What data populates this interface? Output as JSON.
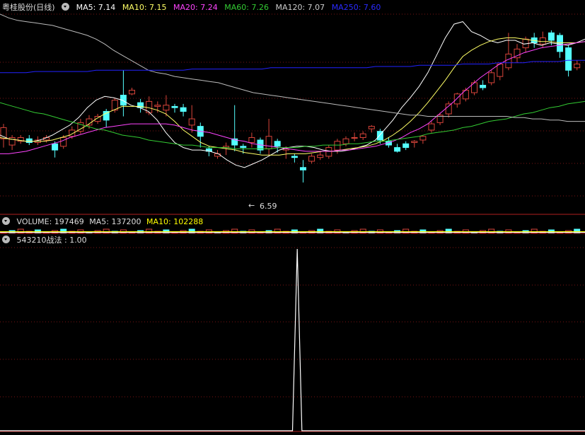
{
  "colors": {
    "bg": "#000000",
    "up": "#d9443a",
    "down": "#54ffff",
    "grid": "#7a1414",
    "ma5": "#ffffff",
    "ma10": "#ffff66",
    "ma20": "#ff44ff",
    "ma60": "#33cc33",
    "ma120": "#bbbbbb",
    "ma250": "#2222ff",
    "vma10": "#ffff00",
    "signal": "#ffffff"
  },
  "header": {
    "stock_name": "粤桂股份(日线)",
    "ma5": "MA5: 7.14",
    "ma10": "MA10: 7.15",
    "ma20": "MA20: 7.24",
    "ma60": "MA60: 7.26",
    "ma120": "MA120: 7.07",
    "ma250": "MA250: 7.60"
  },
  "volume_header": {
    "volume": "VOLUME: 197469",
    "ma5": "MA5: 137200",
    "ma10": "MA10: 102288"
  },
  "indicator_header": {
    "label": "543210战法 : 1.00"
  },
  "annotation": {
    "low_label": "6.59",
    "arrow_icon": "left-arrow-icon"
  },
  "chart_data": [
    {
      "type": "candlestick",
      "title": "粤桂股份(日线)",
      "ylim": [
        6.45,
        8.05
      ],
      "series": [
        {
          "name": "MA5",
          "values": [
            7.08,
            7.05,
            7.04,
            7.03,
            7.03,
            7.05,
            7.08,
            7.12,
            7.16,
            7.22,
            7.3,
            7.36,
            7.39,
            7.38,
            7.36,
            7.32,
            7.3,
            7.27,
            7.2,
            7.1,
            7.02,
            6.98,
            6.96,
            6.96,
            6.95,
            6.93,
            6.88,
            6.84,
            6.82,
            6.85,
            6.88,
            6.92,
            6.96,
            6.98,
            6.99,
            6.99,
            6.98,
            6.96,
            6.95,
            6.95,
            6.96,
            6.98,
            7.0,
            7.04,
            7.12,
            7.2,
            7.3,
            7.38,
            7.47,
            7.58,
            7.72,
            7.86,
            7.97,
            7.99,
            7.91,
            7.88,
            7.84,
            7.82,
            7.84,
            7.84,
            7.81,
            7.82,
            7.8,
            7.82,
            7.81,
            7.8,
            7.82,
            7.85
          ]
        },
        {
          "name": "MA10",
          "values": [
            7.06,
            7.05,
            7.04,
            7.03,
            7.03,
            7.03,
            7.04,
            7.06,
            7.08,
            7.12,
            7.16,
            7.21,
            7.25,
            7.28,
            7.31,
            7.31,
            7.31,
            7.3,
            7.28,
            7.25,
            7.19,
            7.12,
            7.07,
            7.02,
            6.99,
            6.98,
            6.97,
            6.96,
            6.94,
            6.93,
            6.92,
            6.92,
            6.92,
            6.93,
            6.93,
            6.93,
            6.94,
            6.95,
            6.95,
            6.96,
            6.97,
            6.98,
            6.99,
            7.01,
            7.04,
            7.08,
            7.13,
            7.19,
            7.26,
            7.34,
            7.43,
            7.52,
            7.62,
            7.71,
            7.76,
            7.8,
            7.83,
            7.85,
            7.86,
            7.86,
            7.85,
            7.84,
            7.83,
            7.83,
            7.82,
            7.82,
            7.82,
            7.83
          ]
        },
        {
          "name": "MA20",
          "values": [
            6.93,
            6.93,
            6.94,
            6.95,
            6.97,
            6.99,
            7.01,
            7.03,
            7.06,
            7.08,
            7.1,
            7.12,
            7.14,
            7.15,
            7.16,
            7.17,
            7.17,
            7.17,
            7.17,
            7.17,
            7.16,
            7.14,
            7.12,
            7.11,
            7.1,
            7.08,
            7.06,
            7.04,
            7.03,
            7.01,
            7.0,
            6.99,
            6.98,
            6.97,
            6.96,
            6.95,
            6.95,
            6.95,
            6.95,
            6.96,
            6.96,
            6.97,
            6.98,
            6.99,
            7.01,
            7.03,
            7.06,
            7.1,
            7.13,
            7.17,
            7.23,
            7.29,
            7.35,
            7.42,
            7.48,
            7.54,
            7.59,
            7.64,
            7.68,
            7.71,
            7.74,
            7.76,
            7.78,
            7.79,
            7.8,
            7.81,
            7.82,
            7.83
          ]
        },
        {
          "name": "MA60",
          "values": [
            7.34,
            7.32,
            7.3,
            7.28,
            7.26,
            7.25,
            7.23,
            7.21,
            7.19,
            7.17,
            7.15,
            7.13,
            7.12,
            7.1,
            7.08,
            7.07,
            7.06,
            7.04,
            7.03,
            7.02,
            7.01,
            7.0,
            7.0,
            6.99,
            6.98,
            6.98,
            6.98,
            6.97,
            6.97,
            6.97,
            6.97,
            6.97,
            6.98,
            6.98,
            6.98,
            6.99,
            6.99,
            7.0,
            7.0,
            7.0,
            7.01,
            7.01,
            7.02,
            7.03,
            7.03,
            7.04,
            7.05,
            7.06,
            7.07,
            7.09,
            7.1,
            7.11,
            7.12,
            7.14,
            7.15,
            7.17,
            7.19,
            7.2,
            7.21,
            7.23,
            7.25,
            7.26,
            7.28,
            7.3,
            7.31,
            7.33,
            7.34,
            7.35
          ]
        },
        {
          "name": "MA120",
          "values": [
            8.05,
            8.02,
            8.0,
            7.99,
            7.98,
            7.97,
            7.96,
            7.94,
            7.92,
            7.9,
            7.88,
            7.85,
            7.81,
            7.76,
            7.72,
            7.68,
            7.64,
            7.6,
            7.58,
            7.57,
            7.55,
            7.54,
            7.53,
            7.52,
            7.51,
            7.5,
            7.48,
            7.46,
            7.44,
            7.42,
            7.41,
            7.4,
            7.39,
            7.38,
            7.37,
            7.36,
            7.35,
            7.34,
            7.33,
            7.32,
            7.31,
            7.3,
            7.29,
            7.28,
            7.27,
            7.26,
            7.25,
            7.24,
            7.24,
            7.23,
            7.23,
            7.23,
            7.23,
            7.23,
            7.23,
            7.23,
            7.23,
            7.23,
            7.23,
            7.22,
            7.22,
            7.21,
            7.21,
            7.2,
            7.2,
            7.19,
            7.19,
            7.19
          ]
        },
        {
          "name": "MA250",
          "values": [
            7.58,
            7.58,
            7.58,
            7.58,
            7.59,
            7.59,
            7.59,
            7.59,
            7.59,
            7.59,
            7.59,
            7.6,
            7.6,
            7.6,
            7.6,
            7.6,
            7.6,
            7.6,
            7.6,
            7.6,
            7.6,
            7.6,
            7.61,
            7.61,
            7.61,
            7.61,
            7.61,
            7.61,
            7.61,
            7.61,
            7.61,
            7.62,
            7.62,
            7.62,
            7.62,
            7.62,
            7.62,
            7.62,
            7.62,
            7.62,
            7.62,
            7.62,
            7.62,
            7.63,
            7.63,
            7.63,
            7.63,
            7.63,
            7.64,
            7.64,
            7.64,
            7.64,
            7.64,
            7.65,
            7.65,
            7.65,
            7.65,
            7.66,
            7.66,
            7.66,
            7.66,
            7.67,
            7.67,
            7.67,
            7.67,
            7.68,
            7.68,
            7.68
          ]
        }
      ],
      "candles": [
        [
          7.05,
          7.14,
          6.98,
          7.17
        ],
        [
          7.0,
          7.06,
          6.96,
          7.08
        ],
        [
          7.03,
          7.06,
          7.01,
          7.08
        ],
        [
          7.05,
          7.02,
          7.0,
          7.08
        ],
        [
          7.02,
          7.04,
          7.0,
          7.07
        ],
        [
          7.04,
          7.06,
          7.02,
          7.08
        ],
        [
          7.01,
          6.96,
          6.9,
          7.03
        ],
        [
          6.99,
          7.06,
          6.97,
          7.08
        ],
        [
          7.07,
          7.12,
          7.05,
          7.15
        ],
        [
          7.11,
          7.18,
          7.09,
          7.21
        ],
        [
          7.16,
          7.21,
          7.13,
          7.24
        ],
        [
          7.19,
          7.23,
          7.17,
          7.25
        ],
        [
          7.27,
          7.2,
          7.14,
          7.29
        ],
        [
          7.28,
          7.36,
          7.26,
          7.38
        ],
        [
          7.4,
          7.32,
          7.23,
          7.6
        ],
        [
          7.41,
          7.44,
          7.4,
          7.46
        ],
        [
          7.34,
          7.3,
          7.26,
          7.37
        ],
        [
          7.26,
          7.35,
          7.24,
          7.39
        ],
        [
          7.31,
          7.32,
          7.26,
          7.35
        ],
        [
          7.28,
          7.32,
          7.23,
          7.4
        ],
        [
          7.31,
          7.3,
          7.26,
          7.33
        ],
        [
          7.3,
          7.27,
          7.23,
          7.33
        ],
        [
          7.16,
          7.21,
          7.1,
          7.32
        ],
        [
          7.15,
          7.07,
          6.98,
          7.18
        ],
        [
          6.97,
          6.95,
          6.91,
          6.99
        ],
        [
          6.91,
          6.93,
          6.89,
          6.96
        ],
        [
          6.98,
          6.99,
          6.92,
          7.02
        ],
        [
          7.05,
          7.0,
          6.95,
          7.32
        ],
        [
          6.99,
          6.98,
          6.93,
          7.01
        ],
        [
          7.02,
          7.06,
          6.98,
          7.1
        ],
        [
          7.04,
          6.96,
          6.93,
          7.06
        ],
        [
          6.97,
          7.07,
          6.92,
          7.21
        ],
        [
          7.03,
          6.99,
          6.94,
          7.05
        ],
        [
          6.96,
          6.97,
          6.89,
          6.99
        ],
        [
          6.91,
          6.9,
          6.86,
          6.93
        ],
        [
          6.82,
          6.8,
          6.7,
          6.88
        ],
        [
          6.87,
          6.91,
          6.85,
          6.93
        ],
        [
          6.9,
          6.92,
          6.88,
          6.95
        ],
        [
          6.91,
          6.98,
          6.89,
          7.0
        ],
        [
          6.96,
          7.03,
          6.93,
          7.05
        ],
        [
          7.01,
          7.05,
          6.99,
          7.07
        ],
        [
          7.06,
          7.06,
          7.03,
          7.1
        ],
        [
          7.06,
          7.09,
          7.04,
          7.11
        ],
        [
          7.13,
          7.15,
          7.1,
          7.16
        ],
        [
          7.11,
          7.04,
          7.01,
          7.13
        ],
        [
          7.03,
          7.0,
          6.98,
          7.06
        ],
        [
          6.98,
          6.95,
          6.94,
          7.01
        ],
        [
          7.01,
          6.98,
          6.96,
          7.03
        ],
        [
          7.02,
          7.03,
          6.98,
          7.04
        ],
        [
          7.04,
          7.07,
          7.01,
          7.08
        ]
      ],
      "low_label": "6.59"
    },
    {
      "type": "bar",
      "title": "VOLUME",
      "series": [
        {
          "name": "VOLUME",
          "values": [
            197469
          ]
        }
      ]
    },
    {
      "type": "line",
      "title": "543210战法",
      "ylim": [
        0,
        1
      ],
      "series": [
        {
          "name": "543210战法",
          "values": [
            0,
            0,
            0,
            0,
            0,
            0,
            0,
            0,
            0,
            0,
            0,
            0,
            0,
            0,
            0,
            0,
            0,
            0,
            0,
            0,
            0,
            0,
            0,
            0,
            0,
            0,
            0,
            0,
            0,
            0,
            0,
            0,
            0,
            0,
            0,
            0,
            0,
            0,
            0,
            0,
            0,
            0,
            0,
            0,
            0,
            0,
            0,
            0,
            0,
            0,
            0,
            0,
            0,
            0,
            0,
            0,
            0,
            0,
            0,
            0,
            0,
            0,
            0,
            1,
            0,
            0,
            0,
            0,
            0,
            0,
            0,
            0,
            0,
            0,
            0,
            0,
            0,
            0,
            0,
            0,
            0,
            0,
            0,
            0,
            0,
            0,
            0,
            0,
            0,
            0,
            0,
            0,
            0,
            0,
            0,
            0,
            0,
            0,
            0,
            0,
            0,
            0,
            0,
            0,
            0,
            0,
            0,
            0,
            0,
            0,
            0,
            0,
            0,
            0,
            0,
            0,
            0,
            0,
            0,
            0,
            0,
            0,
            0,
            0,
            0
          ]
        }
      ]
    }
  ]
}
